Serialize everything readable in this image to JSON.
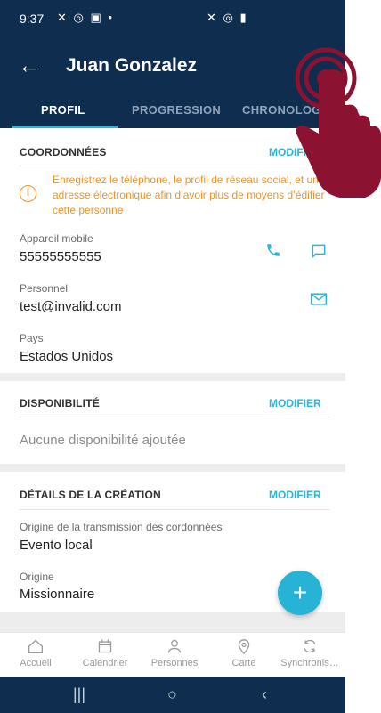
{
  "status_bar": {
    "time": "9:37",
    "left_icons": "✕ ◎ ▣ •",
    "right_icons": "✕ ◎ ▮"
  },
  "app_bar": {
    "title": "Juan Gonzalez",
    "back_icon": "arrow-left-icon",
    "menu_icon": "more-vertical-icon"
  },
  "tabs": [
    {
      "label": "PROFIL",
      "active": true
    },
    {
      "label": "PROGRESSION",
      "active": false
    },
    {
      "label": "CHRONOLOG",
      "active": false
    }
  ],
  "contact": {
    "header": "COORDONNÉES",
    "action": "MODIFIER",
    "warning": "Enregistrez le téléphone, le profil de réseau social, et une adresse électronique afin d’avoir plus de moyens d’édifier cette personne",
    "mobile_label": "Appareil mobile",
    "mobile_value": "55555555555",
    "personal_label": "Personnel",
    "personal_value": "test@invalid.com",
    "country_label": "Pays",
    "country_value": "Estados Unidos"
  },
  "availability": {
    "header": "DISPONIBILITÉ",
    "action": "MODIFIER",
    "empty": "Aucune disponibilité ajoutée"
  },
  "creation": {
    "header": "DÉTAILS DE LA CRÉATION",
    "action": "MODIFIER",
    "transmission_label": "Origine de la transmission des cordonnées",
    "transmission_value": "Evento local",
    "origin_label": "Origine",
    "origin_value": "Missionnaire"
  },
  "fab_icon": "+",
  "bottom_nav": [
    {
      "label": "Accueil",
      "icon": "home-icon"
    },
    {
      "label": "Calendrier",
      "icon": "calendar-icon"
    },
    {
      "label": "Personnes",
      "icon": "person-icon"
    },
    {
      "label": "Carte",
      "icon": "map-pin-icon"
    },
    {
      "label": "Synchronis…",
      "icon": "sync-icon"
    }
  ],
  "system_nav": {
    "recents": "|||",
    "home": "○",
    "back": "‹"
  },
  "colors": {
    "primary": "#0f2d4e",
    "accent": "#2bb5d8",
    "warning": "#e9952b",
    "tap_hand": "#8b1230"
  }
}
